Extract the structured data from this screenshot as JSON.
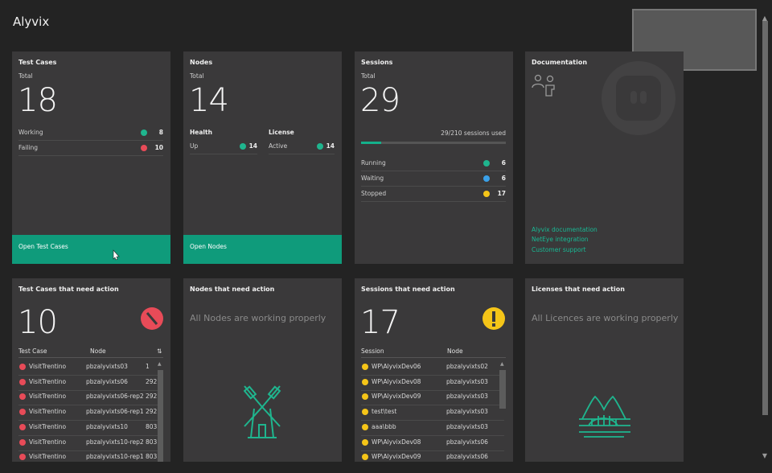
{
  "app": {
    "title": "Alyvix"
  },
  "test_cases": {
    "title": "Test Cases",
    "total_label": "Total",
    "total": "18",
    "rows": [
      {
        "label": "Working",
        "value": "8"
      },
      {
        "label": "Failing",
        "value": "10"
      }
    ],
    "cta": "Open Test Cases"
  },
  "nodes": {
    "title": "Nodes",
    "total_label": "Total",
    "total": "14",
    "health_label": "Health",
    "license_label": "License",
    "health": {
      "label": "Up",
      "value": "14"
    },
    "license": {
      "label": "Active",
      "value": "14"
    },
    "cta": "Open Nodes"
  },
  "sessions": {
    "title": "Sessions",
    "total_label": "Total",
    "total": "29",
    "used_text": "29/210 sessions used",
    "used_fraction": 0.138,
    "rows": [
      {
        "label": "Running",
        "value": "6"
      },
      {
        "label": "Waiting",
        "value": "6"
      },
      {
        "label": "Stopped",
        "value": "17"
      }
    ]
  },
  "documentation": {
    "title": "Documentation",
    "links": [
      "Alyvix documentation",
      "NetEye integration",
      "Customer support"
    ]
  },
  "tc_action": {
    "title": "Test Cases that need action",
    "count": "10",
    "col_test": "Test Case",
    "col_node": "Node",
    "rows": [
      {
        "name": "VisitTrentino",
        "node": "pbzalyvixts03",
        "c": "1"
      },
      {
        "name": "VisitTrentino",
        "node": "pbzalyvixts06",
        "c": "292"
      },
      {
        "name": "VisitTrentino",
        "node": "pbzalyvixts06-rep2",
        "c": "292"
      },
      {
        "name": "VisitTrentino",
        "node": "pbzalyvixts06-rep1",
        "c": "292"
      },
      {
        "name": "VisitTrentino",
        "node": "pbzalyvixts10",
        "c": "803"
      },
      {
        "name": "VisitTrentino",
        "node": "pbzalyvixts10-rep2",
        "c": "803"
      },
      {
        "name": "VisitTrentino",
        "node": "pbzalyvixts10-rep1",
        "c": "803"
      }
    ]
  },
  "nodes_action": {
    "title": "Nodes that need action",
    "message": "All Nodes are working properly"
  },
  "sessions_action": {
    "title": "Sessions that need action",
    "count": "17",
    "col_session": "Session",
    "col_node": "Node",
    "rows": [
      {
        "name": "WP\\AlyvixDev06",
        "node": "pbzalyvixts02"
      },
      {
        "name": "WP\\AlyvixDev08",
        "node": "pbzalyvixts03"
      },
      {
        "name": "WP\\AlyvixDev09",
        "node": "pbzalyvixts03"
      },
      {
        "name": "test\\test",
        "node": "pbzalyvixts03"
      },
      {
        "name": "aaa\\bbb",
        "node": "pbzalyvixts03"
      },
      {
        "name": "WP\\AlyvixDev08",
        "node": "pbzalyvixts06"
      },
      {
        "name": "WP\\AlyvixDev09",
        "node": "pbzalyvixts06"
      }
    ]
  },
  "licenses_action": {
    "title": "Licenses that need action",
    "message": "All Licences are working properly"
  },
  "colors": {
    "accent": "#0f9b7b",
    "link": "#19b894",
    "danger": "#e84b58",
    "warning": "#f5c518",
    "info": "#3aa0e8",
    "success": "#1fb58e"
  }
}
